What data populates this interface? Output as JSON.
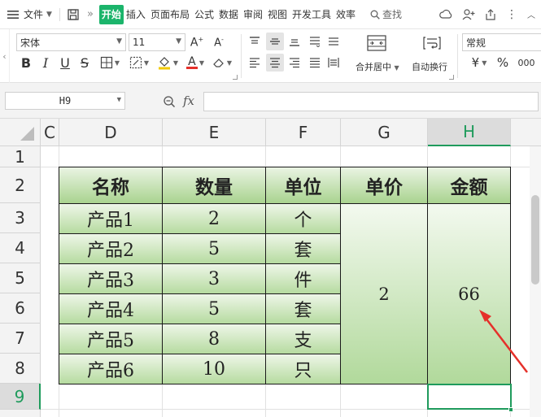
{
  "menubar": {
    "menu_icon": "hamburger-icon",
    "file_label": "文件",
    "save_icon": "save-icon",
    "tabs": [
      "开始",
      "插入",
      "页面布局",
      "公式",
      "数据",
      "审阅",
      "视图",
      "开发工具",
      "效率"
    ],
    "active_tab": "开始",
    "search_label": "查找"
  },
  "ribbon": {
    "font_name": "宋体",
    "font_size": "11",
    "merge_center_label": "合并居中",
    "wrap_text_label": "自动换行",
    "number_format": "常规",
    "currency_symbol": "¥",
    "percent_symbol": "%",
    "thousands_symbol": "000"
  },
  "formula_bar": {
    "name_box": "H9",
    "fx_label": "fx",
    "formula": ""
  },
  "sheet": {
    "columns": [
      "C",
      "D",
      "E",
      "F",
      "G",
      "H"
    ],
    "active_column": "H",
    "rows": [
      "1",
      "2",
      "3",
      "4",
      "5",
      "6",
      "7",
      "8",
      "9"
    ],
    "active_row": "9",
    "headers": [
      "名称",
      "数量",
      "单位",
      "单价",
      "金额"
    ],
    "items": [
      {
        "name": "产品1",
        "qty": "2",
        "unit": "个"
      },
      {
        "name": "产品2",
        "qty": "5",
        "unit": "套"
      },
      {
        "name": "产品3",
        "qty": "3",
        "unit": "件"
      },
      {
        "name": "产品4",
        "qty": "5",
        "unit": "套"
      },
      {
        "name": "产品5",
        "qty": "8",
        "unit": "支"
      },
      {
        "name": "产品6",
        "qty": "10",
        "unit": "只"
      }
    ],
    "unit_price": "2",
    "amount": "66"
  },
  "colors": {
    "accent": "#1f9b5c",
    "active_tab_bg": "#1bb46b",
    "header_fill_top": "#eaf4e3",
    "header_fill_bottom": "#a9d38f",
    "arrow_red": "#e5302a"
  }
}
